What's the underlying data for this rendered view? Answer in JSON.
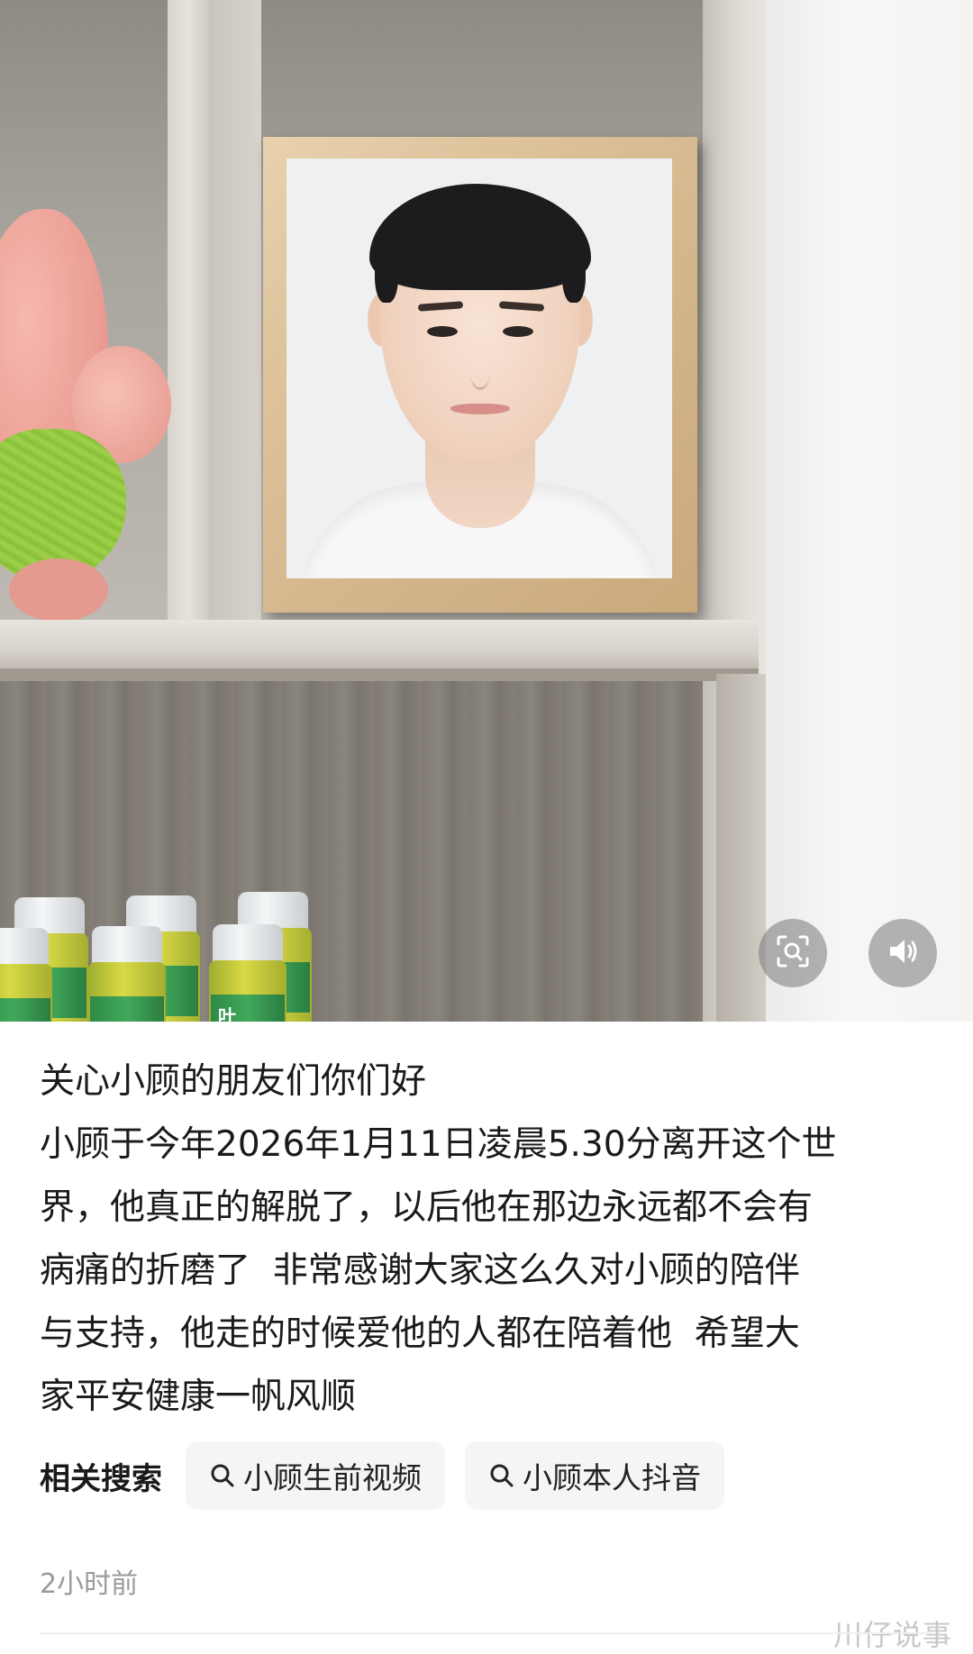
{
  "post": {
    "lines": [
      "关心小顾的朋友们你们好",
      "小顾于今年2026年1月11日凌晨5.30分离开这个世",
      "界，他真正的解脱了，以后他在那边永远都不会有",
      "病痛的折磨了  非常感谢大家这么久对小顾的陪伴",
      "与支持，他走的时候爱他的人都在陪着他  希望大",
      "家平安健康一帆风顺"
    ],
    "time": "2小时前"
  },
  "related": {
    "label": "相关搜索",
    "chips": [
      {
        "text": "小顾生前视频",
        "icon": "search-icon"
      },
      {
        "text": "小顾本人抖音",
        "icon": "search-icon"
      }
    ]
  },
  "photo_bottles": {
    "label_text": "叶"
  },
  "overlay": {
    "icons": [
      "scan-search-icon",
      "speaker-icon"
    ]
  },
  "watermark": "川仔说事",
  "colors": {
    "text": "#1a1a1a",
    "muted": "#9a9a9a",
    "chip_bg": "#f4f5f7"
  }
}
